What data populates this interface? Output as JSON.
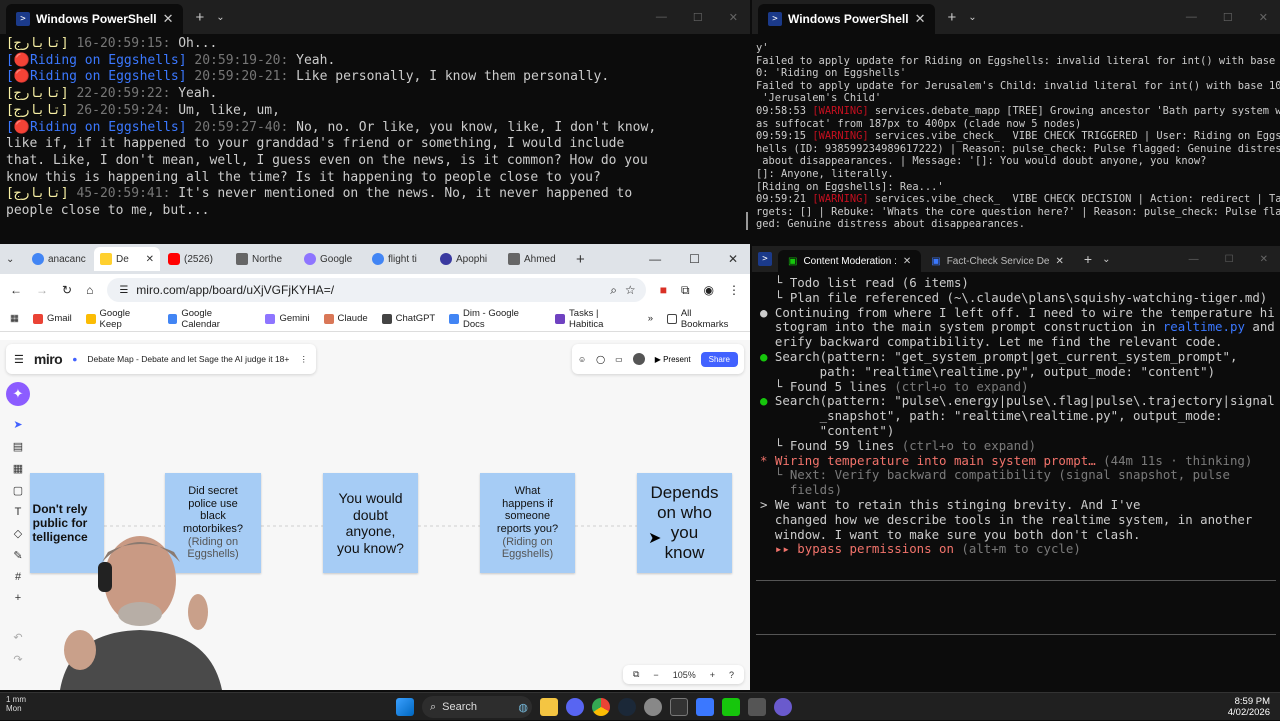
{
  "ps_left": {
    "tab_title": "Windows PowerShell",
    "lines": [
      [
        [
          "gold",
          "[تابارج]"
        ],
        [
          "ts",
          " 20:59:15-16:"
        ],
        [
          "w",
          " Oh..."
        ]
      ],
      [
        [
          "blue",
          "["
        ],
        [
          "red",
          "🔴"
        ],
        [
          "blue",
          "Riding on Eggshells]"
        ],
        [
          "ts",
          " 20:59:19-20:"
        ],
        [
          "w",
          " Yeah."
        ]
      ],
      [
        [
          "blue",
          "["
        ],
        [
          "red",
          "🔴"
        ],
        [
          "blue",
          "Riding on Eggshells]"
        ],
        [
          "ts",
          " 20:59:20-21:"
        ],
        [
          "w",
          " Like personally, I know them personally."
        ]
      ],
      [
        [
          "gold",
          "[تابارج]"
        ],
        [
          "ts",
          " 20:59:22-22:"
        ],
        [
          "w",
          " Yeah."
        ]
      ],
      [
        [
          "gold",
          "[تابارج]"
        ],
        [
          "ts",
          " 20:59:24-26:"
        ],
        [
          "w",
          " Um, like, um,"
        ]
      ],
      [
        [
          "blue",
          "["
        ],
        [
          "red",
          "🔴"
        ],
        [
          "blue",
          "Riding on Eggshells]"
        ],
        [
          "ts",
          " 20:59:27-40:"
        ],
        [
          "w",
          " No, no. Or like, you know, like, I don't know,"
        ]
      ],
      [
        [
          "w",
          "like if, if it happened to your granddad's friend or something, I would include"
        ]
      ],
      [
        [
          "w",
          "that. Like, I don't mean, well, I guess even on the news, is it common? How do you"
        ]
      ],
      [
        [
          "w",
          "know this is happening all the time? Is it happening to people close to you?"
        ]
      ],
      [
        [
          "gold",
          "[تابارج]"
        ],
        [
          "ts",
          " 20:59:41-45:"
        ],
        [
          "w",
          " It's never mentioned on the news. No, it never happened to"
        ]
      ],
      [
        [
          "w",
          "people close to me, but..."
        ]
      ]
    ]
  },
  "ps_right": {
    "tab_title": "Windows PowerShell",
    "lines": [
      [
        [
          "w",
          "y'"
        ]
      ],
      [
        [
          "w",
          "Failed to apply update for Riding on Eggshells: invalid literal for int() with base 1"
        ]
      ],
      [
        [
          "w",
          "0: 'Riding on Eggshells'"
        ]
      ],
      [
        [
          "w",
          "Failed to apply update for Jerusalem's Child: invalid literal for int() with base 10:"
        ]
      ],
      [
        [
          "w",
          " 'Jerusalem's Child'"
        ]
      ],
      [
        [
          "w",
          "09:58:53 "
        ],
        [
          "warn",
          "[WARNING]"
        ],
        [
          "w",
          " services.debate_mapp [TREE] Growing ancestor 'Bath party system w"
        ]
      ],
      [
        [
          "w",
          "as suffocat' from 187px to 400px (clade now 5 nodes)"
        ]
      ],
      [
        [
          "w",
          "09:59:15 "
        ],
        [
          "warn",
          "[WARNING]"
        ],
        [
          "w",
          " services.vibe_check_  VIBE CHECK TRIGGERED | User: Riding on Eggs"
        ]
      ],
      [
        [
          "w",
          "hells (ID: 938599234989617222) | Reason: pulse_check: Pulse flagged: Genuine distress"
        ]
      ],
      [
        [
          "w",
          " about disappearances. | Message: '[]: You would doubt anyone, you know?"
        ]
      ],
      [
        [
          "w",
          "[]: Anyone, literally."
        ]
      ],
      [
        [
          "w",
          "[Riding on Eggshells]: Rea...'"
        ]
      ],
      [
        [
          "w",
          "09:59:21 "
        ],
        [
          "warn",
          "[WARNING]"
        ],
        [
          "w",
          " services.vibe_check_  VIBE CHECK DECISION | Action: redirect | Ta"
        ]
      ],
      [
        [
          "w",
          "rgets: [] | Rebuke: 'Whats the core question here?' | Reason: pulse_check: Pulse flag"
        ]
      ],
      [
        [
          "w",
          "ged: Genuine distress about disappearances."
        ]
      ]
    ]
  },
  "claude_term": {
    "tab1": "Content Moderation :",
    "tab2": "Fact-Check Service De",
    "lines": [
      [
        [
          "w",
          "  └ Todo list read (6 items)"
        ]
      ],
      [
        [
          "w",
          "  └ Plan file referenced (~\\.claude\\plans\\squishy-watching-tiger.md)"
        ]
      ],
      [
        [
          "w",
          ""
        ]
      ],
      [
        [
          "w",
          "● Continuing from where I left off. I need to wire the temperature hi"
        ]
      ],
      [
        [
          "w",
          "  stogram into the main system prompt construction in "
        ],
        [
          "blue",
          "realtime.py"
        ],
        [
          "w",
          " and v"
        ]
      ],
      [
        [
          "w",
          "  erify backward compatibility. Let me find the relevant code."
        ]
      ],
      [
        [
          "w",
          ""
        ]
      ],
      [
        [
          "green",
          "●"
        ],
        [
          "w",
          " Search(pattern: \"get_system_prompt|get_current_system_prompt\","
        ]
      ],
      [
        [
          "w",
          "        path: \"realtime\\realtime.py\", output_mode: \"content\")"
        ]
      ],
      [
        [
          "w",
          "  └ Found 5 lines "
        ],
        [
          "dim",
          "(ctrl+o to expand)"
        ]
      ],
      [
        [
          "w",
          ""
        ]
      ],
      [
        [
          "green",
          "●"
        ],
        [
          "w",
          " Search(pattern: \"pulse\\.energy|pulse\\.flag|pulse\\.trajectory|signal"
        ]
      ],
      [
        [
          "w",
          "        _snapshot\", path: \"realtime\\realtime.py\", output_mode:"
        ]
      ],
      [
        [
          "w",
          "        \"content\")"
        ]
      ],
      [
        [
          "w",
          "  └ Found 59 lines "
        ],
        [
          "dim",
          "(ctrl+o to expand)"
        ]
      ],
      [
        [
          "w",
          ""
        ]
      ],
      [
        [
          "orange",
          "* Wiring temperature into main system prompt… "
        ],
        [
          "dim",
          "(44m 11s · thinking)"
        ]
      ],
      [
        [
          "dim",
          "  └ Next: Verify backward compatibility (signal snapshot, pulse"
        ]
      ],
      [
        [
          "dim",
          "    fields)"
        ]
      ],
      [
        [
          "w",
          ""
        ]
      ],
      [
        [
          "w",
          ""
        ]
      ],
      [
        [
          "w",
          "> We want to retain this stinging brevity. And I've"
        ]
      ],
      [
        [
          "w",
          "  changed how we describe tools in the realtime system, in another"
        ]
      ],
      [
        [
          "w",
          "  window. I want to make sure you both don't clash."
        ]
      ],
      [
        [
          "w",
          ""
        ]
      ],
      [
        [
          "w",
          ""
        ]
      ],
      [
        [
          "orange",
          "  ▸▸ bypass permissions on "
        ],
        [
          "dim",
          "(alt+m to cycle)"
        ]
      ]
    ]
  },
  "chrome": {
    "tabs": [
      "anacanc",
      "De",
      "(2526)",
      "Northe",
      "Google",
      "flight ti",
      "Apophi",
      "Ahmed"
    ],
    "url": "miro.com/app/board/uXjVGFjKYHA=/",
    "bookmarks": [
      "Gmail",
      "Google Keep",
      "Google Calendar",
      "Gemini",
      "Claude",
      "ChatGPT",
      "Dim - Google Docs",
      "Tasks | Habitica"
    ],
    "all_bookmarks": "All Bookmarks"
  },
  "miro": {
    "logo": "miro",
    "board_title": "Debate Map - Debate and let Sage the AI judge it 18+",
    "present": "Present",
    "share": "Share",
    "zoom": "105%",
    "cards": [
      {
        "text": "Don't rely\npublic for\ntelligence",
        "sub": ""
      },
      {
        "text": "Did secret\npolice use\nblack\nmotorbikes?",
        "sub": "(Riding on\nEggshells)"
      },
      {
        "text": "You would\ndoubt\nanyone,\nyou know?",
        "sub": ""
      },
      {
        "text": "What\nhappens if\nsomeone\nreports you?",
        "sub": "(Riding on\nEggshells)"
      },
      {
        "text": "Depends\non who\nyou\nknow",
        "sub": ""
      }
    ]
  },
  "taskbar": {
    "search": "Search",
    "time": "8:59 PM",
    "date": "4/02/2026",
    "notif": "1 mm",
    "notif2": "Mon"
  }
}
